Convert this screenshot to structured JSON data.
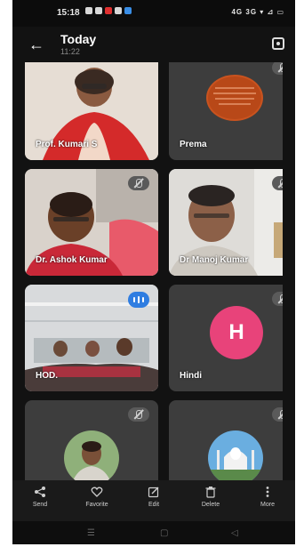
{
  "status": {
    "time": "15:18",
    "right": "4G 3G ▾ ⊿ ▭"
  },
  "header": {
    "title": "Today",
    "subtitle": "11:22",
    "back_icon": "arrow-left-icon",
    "action_icon": "lens-icon"
  },
  "participants": [
    {
      "name": "Prof. Kumari S",
      "state": "active"
    },
    {
      "name": "Prema",
      "state": "muted"
    },
    {
      "name": "Dr. Ashok Kumar",
      "state": "muted"
    },
    {
      "name": "Dr Manoj Kumar",
      "state": "muted"
    },
    {
      "name": "HOD.",
      "state": "speaking"
    },
    {
      "name": "Hindi",
      "state": "muted",
      "avatar_letter": "H"
    },
    {
      "name": "",
      "state": "muted"
    },
    {
      "name": "",
      "state": "muted"
    }
  ],
  "colors": {
    "avatar_pink": "#e8437a",
    "speaking_blue": "#2f7de1",
    "background": "#121212"
  },
  "toolbar": {
    "items": [
      {
        "label": "Send",
        "icon": "share-icon"
      },
      {
        "label": "Favorite",
        "icon": "heart-icon"
      },
      {
        "label": "Edit",
        "icon": "edit-icon"
      },
      {
        "label": "Delete",
        "icon": "trash-icon"
      },
      {
        "label": "More",
        "icon": "more-vertical-icon"
      }
    ]
  },
  "navbar": {
    "items": [
      "menu-nav-icon",
      "home-nav-icon",
      "back-nav-icon"
    ]
  }
}
